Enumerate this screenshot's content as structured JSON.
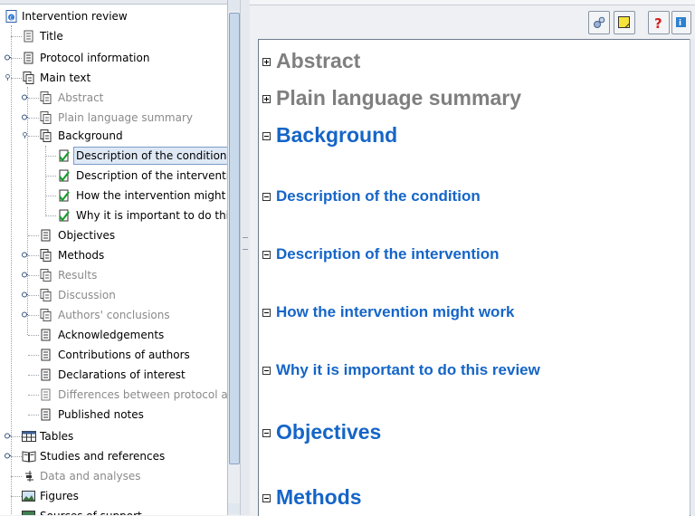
{
  "tree": {
    "root": "Intervention review",
    "items": [
      {
        "label": "Title",
        "disabled": false
      },
      {
        "label": "Protocol information",
        "disabled": false
      },
      {
        "label": "Main text",
        "disabled": false
      },
      {
        "label": "Abstract",
        "disabled": true
      },
      {
        "label": "Plain language summary",
        "disabled": true
      },
      {
        "label": "Background",
        "disabled": false
      },
      {
        "label": "Description of the condition",
        "disabled": false,
        "selected": true
      },
      {
        "label": "Description of the intervention",
        "disabled": false
      },
      {
        "label": "How the intervention might work",
        "disabled": false
      },
      {
        "label": "Why it is important to do this review",
        "disabled": false
      },
      {
        "label": "Objectives",
        "disabled": false
      },
      {
        "label": "Methods",
        "disabled": false
      },
      {
        "label": "Results",
        "disabled": true
      },
      {
        "label": "Discussion",
        "disabled": true
      },
      {
        "label": "Authors' conclusions",
        "disabled": true
      },
      {
        "label": "Acknowledgements",
        "disabled": false
      },
      {
        "label": "Contributions of authors",
        "disabled": false
      },
      {
        "label": "Declarations of interest",
        "disabled": false
      },
      {
        "label": "Differences between protocol and review",
        "disabled": true
      },
      {
        "label": "Published notes",
        "disabled": false
      },
      {
        "label": "Tables",
        "disabled": false
      },
      {
        "label": "Studies and references",
        "disabled": false
      },
      {
        "label": "Data and analyses",
        "disabled": true
      },
      {
        "label": "Figures",
        "disabled": false
      },
      {
        "label": "Sources of support",
        "disabled": false
      }
    ]
  },
  "document": {
    "sections": [
      {
        "label": "Abstract",
        "style": "grey"
      },
      {
        "label": "Plain language summary",
        "style": "grey"
      },
      {
        "label": "Background",
        "style": "blue"
      },
      {
        "label": "Description of the condition",
        "style": "blue"
      },
      {
        "label": "Description of the intervention",
        "style": "blue"
      },
      {
        "label": "How the intervention might work",
        "style": "blue"
      },
      {
        "label": "Why it is important to do this review",
        "style": "blue"
      },
      {
        "label": "Objectives",
        "style": "blue"
      },
      {
        "label": "Methods",
        "style": "blue"
      }
    ]
  },
  "toolbar": {
    "buttons": [
      "settings-icon",
      "note-icon",
      "help-icon",
      "info-icon"
    ]
  },
  "colors": {
    "heading_blue": "#1565c7",
    "heading_grey": "#7f7f7f",
    "selection": "#dfe9f6"
  }
}
